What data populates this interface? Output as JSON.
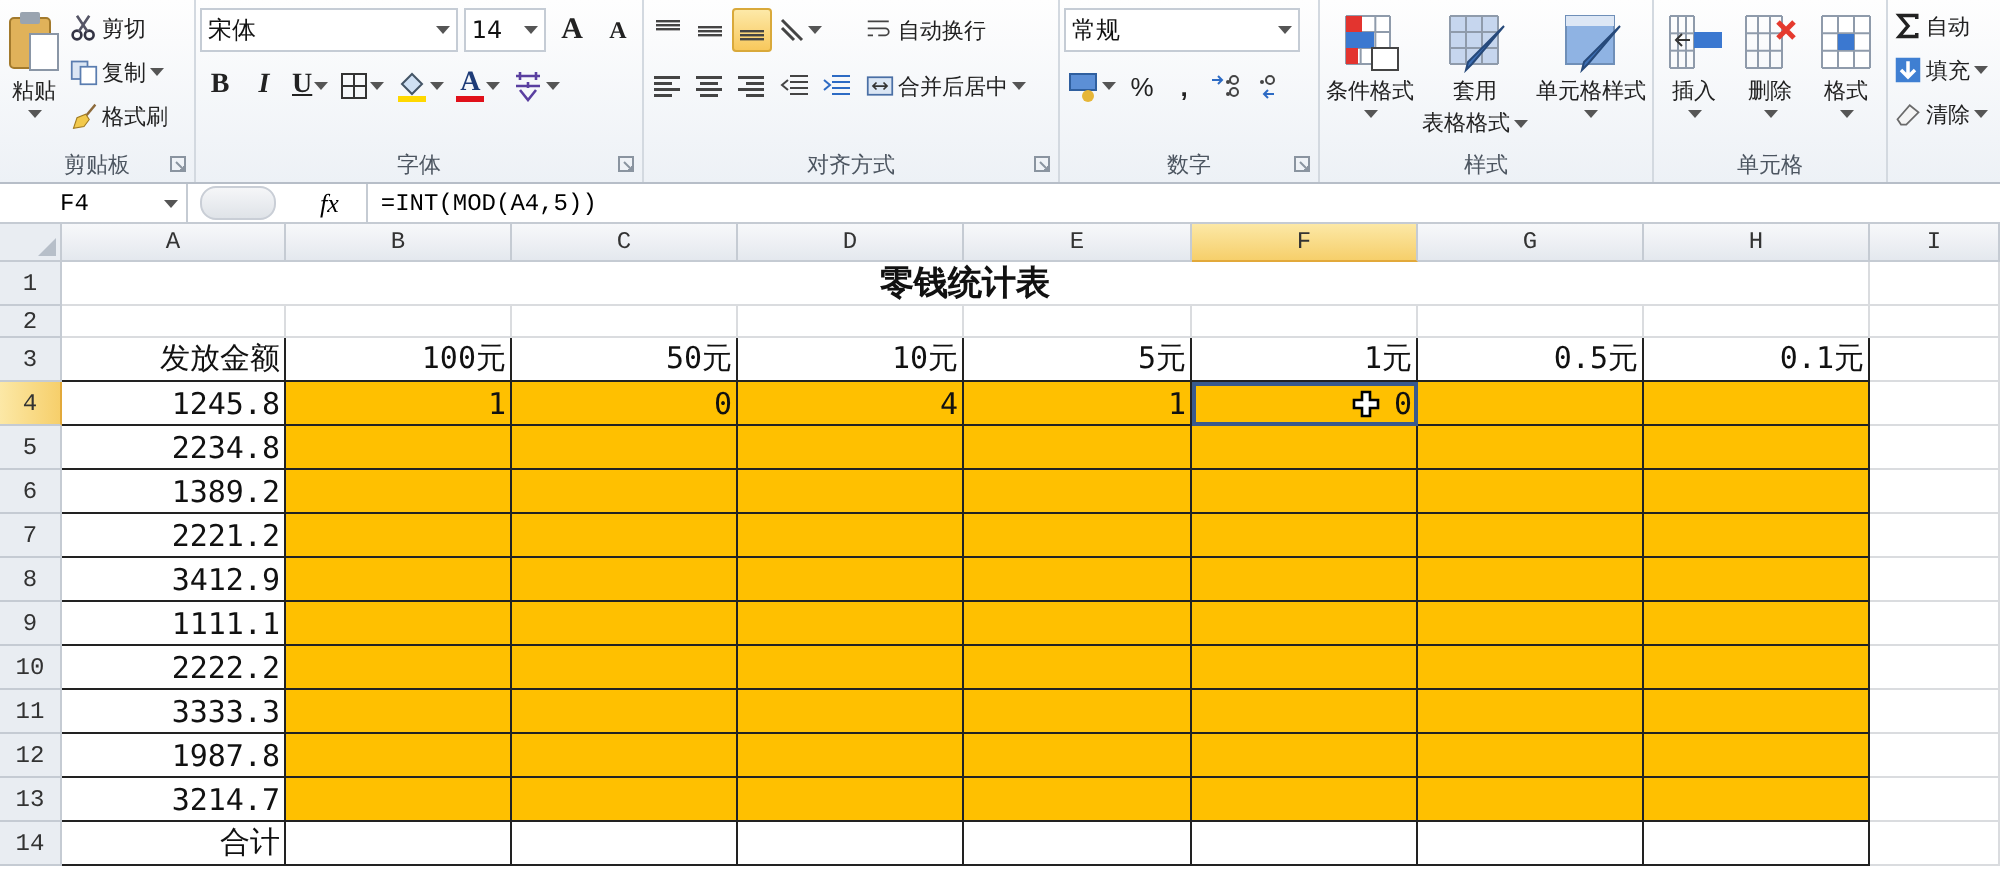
{
  "ribbon": {
    "clipboard": {
      "label": "剪贴板",
      "paste": "粘贴",
      "items": [
        {
          "kind": "cut",
          "label": "剪切",
          "dropdown": false
        },
        {
          "kind": "copy",
          "label": "复制",
          "dropdown": true
        },
        {
          "kind": "brush",
          "label": "格式刷",
          "dropdown": false
        }
      ]
    },
    "font": {
      "label": "字体",
      "font_name": "宋体",
      "font_size": "14",
      "size_buttons": [
        "A",
        "A"
      ],
      "style_buttons": [
        "B",
        "I",
        "U"
      ],
      "font_color_button": "A"
    },
    "alignment": {
      "label": "对齐方式",
      "vertical": [
        {
          "selected": false
        },
        {
          "selected": false
        },
        {
          "selected": true
        }
      ],
      "horizontal": [
        {
          "selected": false
        },
        {
          "selected": false
        },
        {
          "selected": false
        }
      ],
      "wrap": "自动换行",
      "merge": "合并后居中"
    },
    "number": {
      "label": "数字",
      "format": "常规",
      "symbols": [
        "%",
        ","
      ]
    },
    "styles": {
      "label": "样式",
      "buttons": [
        {
          "kind": "conditional",
          "lines": [
            "条件格式"
          ]
        },
        {
          "kind": "table",
          "lines": [
            "套用",
            "表格格式"
          ]
        },
        {
          "kind": "cellstyle",
          "lines": [
            "单元格样式"
          ]
        }
      ]
    },
    "cells": {
      "label": "单元格",
      "buttons": [
        {
          "kind": "insert",
          "label": "插入"
        },
        {
          "kind": "delete",
          "label": "删除"
        },
        {
          "kind": "format",
          "label": "格式"
        }
      ]
    },
    "editing": {
      "items": [
        {
          "kind": "sum",
          "label": "自动",
          "dropdown": false
        },
        {
          "kind": "fill",
          "label": "填充",
          "dropdown": true
        },
        {
          "kind": "clear",
          "label": "清除",
          "dropdown": true
        }
      ]
    }
  },
  "formula_bar": {
    "name_box": "F4",
    "fx": "fx",
    "formula": "=INT(MOD(A4,5))"
  },
  "sheet": {
    "columns": [
      {
        "label": "A",
        "selected": false
      },
      {
        "label": "B",
        "selected": false
      },
      {
        "label": "C",
        "selected": false
      },
      {
        "label": "D",
        "selected": false
      },
      {
        "label": "E",
        "selected": false
      },
      {
        "label": "F",
        "selected": true
      },
      {
        "label": "G",
        "selected": false
      },
      {
        "label": "H",
        "selected": false
      },
      {
        "label": "I",
        "selected": false
      }
    ],
    "rows": [
      {
        "number": "1",
        "selected": false,
        "kind": "title",
        "text": "零钱统计表"
      },
      {
        "number": "2",
        "selected": false,
        "kind": "blank"
      },
      {
        "number": "3",
        "selected": false,
        "kind": "header",
        "labels": [
          "发放金额",
          "100元",
          "50元",
          "10元",
          "5元",
          "1元",
          "0.5元",
          "0.1元"
        ]
      },
      {
        "number": "4",
        "selected": true,
        "kind": "data",
        "amount": "1245.8",
        "counts": [
          "1",
          "0",
          "4",
          "1",
          "0"
        ],
        "filled": true
      },
      {
        "number": "5",
        "selected": false,
        "kind": "data",
        "amount": "2234.8",
        "filled": true
      },
      {
        "number": "6",
        "selected": false,
        "kind": "data",
        "amount": "1389.2",
        "filled": true
      },
      {
        "number": "7",
        "selected": false,
        "kind": "data",
        "amount": "2221.2",
        "filled": true
      },
      {
        "number": "8",
        "selected": false,
        "kind": "data",
        "amount": "3412.9",
        "filled": true
      },
      {
        "number": "9",
        "selected": false,
        "kind": "data",
        "amount": "1111.1",
        "filled": true
      },
      {
        "number": "10",
        "selected": false,
        "kind": "data",
        "amount": "2222.2",
        "filled": true
      },
      {
        "number": "11",
        "selected": false,
        "kind": "data",
        "amount": "3333.3",
        "filled": true
      },
      {
        "number": "12",
        "selected": false,
        "kind": "data",
        "amount": "1987.8",
        "filled": true
      },
      {
        "number": "13",
        "selected": false,
        "kind": "data",
        "amount": "3214.7",
        "filled": true
      },
      {
        "number": "14",
        "selected": false,
        "kind": "total",
        "label": "合计"
      }
    ]
  }
}
